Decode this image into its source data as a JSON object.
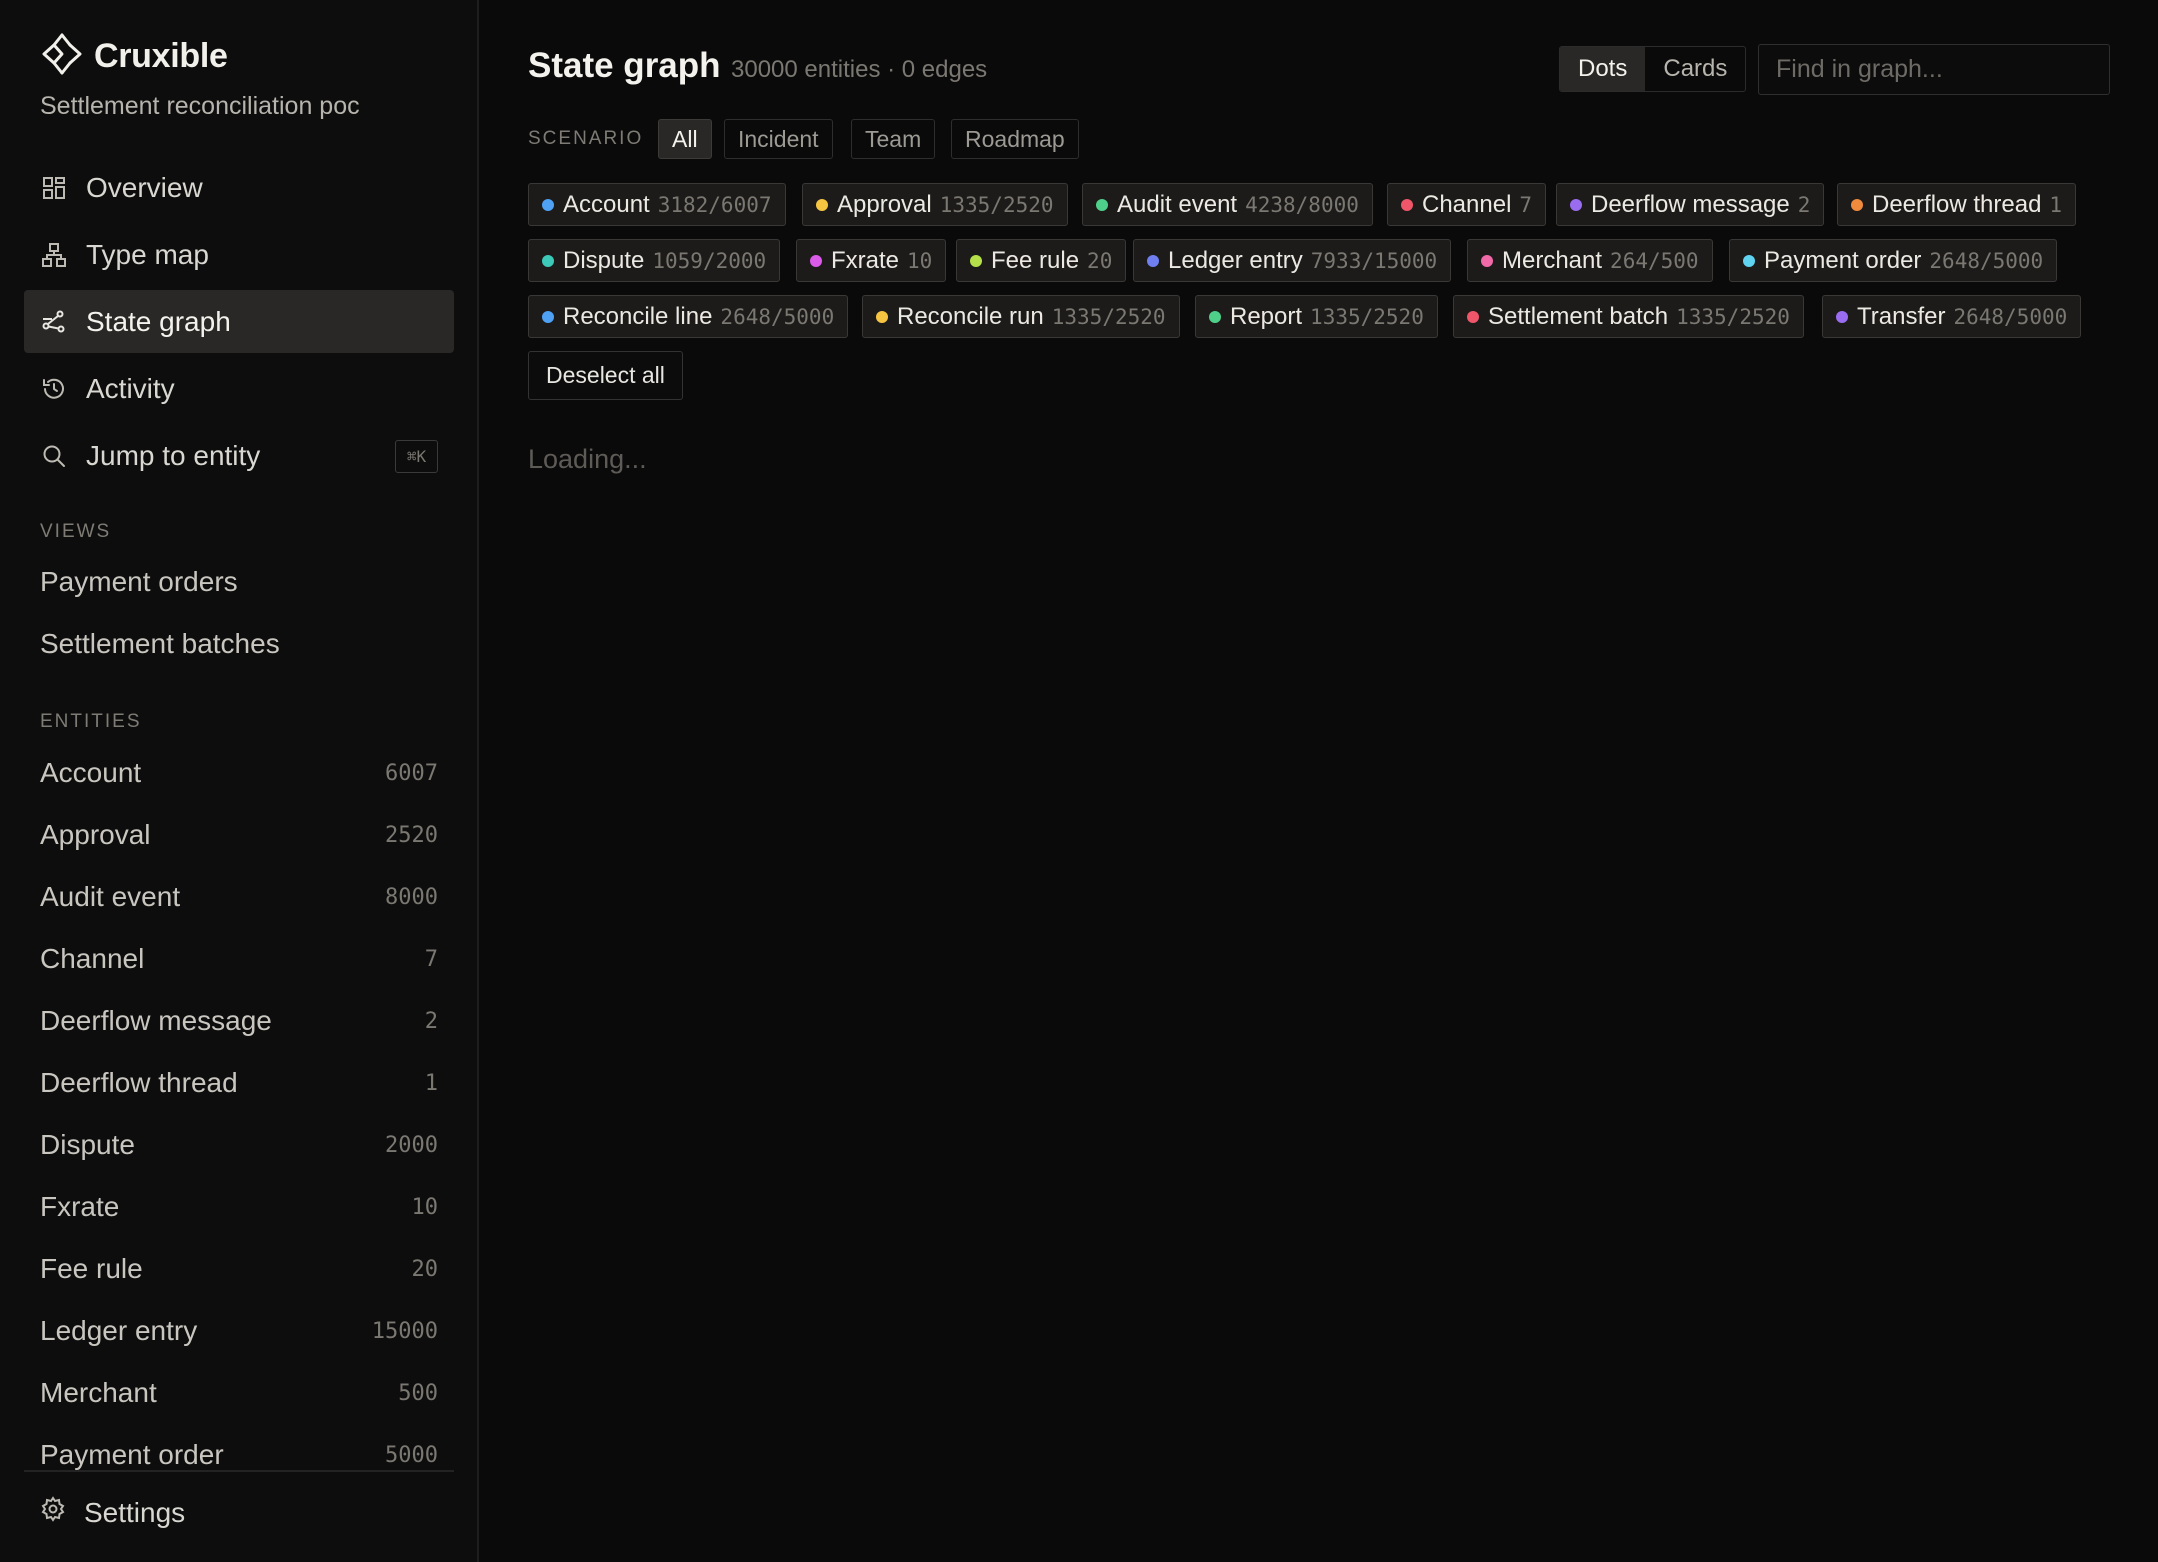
{
  "app": {
    "name": "Cruxible",
    "project": "Settlement reconciliation poc"
  },
  "nav": [
    {
      "label": "Overview",
      "icon": "grid-icon"
    },
    {
      "label": "Type map",
      "icon": "hierarchy-icon"
    },
    {
      "label": "State graph",
      "icon": "graph-icon",
      "active": true
    },
    {
      "label": "Activity",
      "icon": "history-icon"
    },
    {
      "label": "Jump to entity",
      "icon": "search-icon",
      "shortcut": "⌘K"
    }
  ],
  "views": {
    "heading": "VIEWS",
    "items": [
      "Payment orders",
      "Settlement batches"
    ]
  },
  "entities": {
    "heading": "ENTITIES",
    "items": [
      {
        "name": "Account",
        "count": "6007"
      },
      {
        "name": "Approval",
        "count": "2520"
      },
      {
        "name": "Audit event",
        "count": "8000"
      },
      {
        "name": "Channel",
        "count": "7"
      },
      {
        "name": "Deerflow message",
        "count": "2"
      },
      {
        "name": "Deerflow thread",
        "count": "1"
      },
      {
        "name": "Dispute",
        "count": "2000"
      },
      {
        "name": "Fxrate",
        "count": "10"
      },
      {
        "name": "Fee rule",
        "count": "20"
      },
      {
        "name": "Ledger entry",
        "count": "15000"
      },
      {
        "name": "Merchant",
        "count": "500"
      },
      {
        "name": "Payment order",
        "count": "5000"
      }
    ]
  },
  "settings": {
    "label": "Settings"
  },
  "header": {
    "title": "State graph",
    "subtitle": "30000 entities · 0 edges",
    "view_modes": [
      "Dots",
      "Cards"
    ],
    "active_view_mode": "Dots",
    "search_placeholder": "Find in graph..."
  },
  "scenario": {
    "label": "SCENARIO",
    "options": [
      "All",
      "Incident",
      "Team",
      "Roadmap"
    ],
    "active": "All"
  },
  "type_chips": [
    {
      "label": "Account",
      "count": "3182/6007",
      "color": "#4ea1f3"
    },
    {
      "label": "Approval",
      "count": "1335/2520",
      "color": "#f5c542"
    },
    {
      "label": "Audit event",
      "count": "4238/8000",
      "color": "#4fd08a"
    },
    {
      "label": "Channel",
      "count": "7",
      "color": "#f0566a"
    },
    {
      "label": "Deerflow message",
      "count": "2",
      "color": "#9a6cf0"
    },
    {
      "label": "Deerflow thread",
      "count": "1",
      "color": "#f08a3c"
    },
    {
      "label": "Dispute",
      "count": "1059/2000",
      "color": "#3cc9b8"
    },
    {
      "label": "Fxrate",
      "count": "10",
      "color": "#d95be8"
    },
    {
      "label": "Fee rule",
      "count": "20",
      "color": "#b5e04a"
    },
    {
      "label": "Ledger entry",
      "count": "7933/15000",
      "color": "#6f7ff0"
    },
    {
      "label": "Merchant",
      "count": "264/500",
      "color": "#f06aa8"
    },
    {
      "label": "Payment order",
      "count": "2648/5000",
      "color": "#5fd3f0"
    },
    {
      "label": "Reconcile line",
      "count": "2648/5000",
      "color": "#4ea1f3"
    },
    {
      "label": "Reconcile run",
      "count": "1335/2520",
      "color": "#f5c542"
    },
    {
      "label": "Report",
      "count": "1335/2520",
      "color": "#4fd08a"
    },
    {
      "label": "Settlement batch",
      "count": "1335/2520",
      "color": "#f0566a"
    },
    {
      "label": "Transfer",
      "count": "2648/5000",
      "color": "#9a6cf0"
    }
  ],
  "deselect_label": "Deselect all",
  "loading_text": "Loading..."
}
